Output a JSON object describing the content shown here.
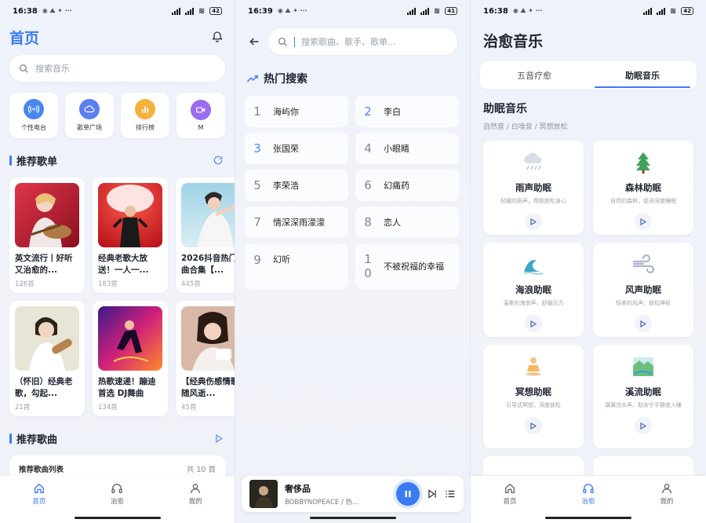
{
  "screen1": {
    "status": {
      "time": "16:38",
      "battery": "42"
    },
    "title": "首页",
    "search_placeholder": "搜索音乐",
    "quick": [
      {
        "label": "个性电台",
        "icon": "radio-icon",
        "color": "#4a86f0"
      },
      {
        "label": "歌单广场",
        "icon": "cloud-icon",
        "color": "#5b7ff0"
      },
      {
        "label": "排行榜",
        "icon": "chart-icon",
        "color": "#f3b23a"
      },
      {
        "label": "M",
        "icon": "video-icon",
        "color": "#9b6cf0"
      }
    ],
    "recommend_title": "推荐歌单",
    "playlists": [
      {
        "title": "英文流行丨好听又治愈的...",
        "count": "126首"
      },
      {
        "title": "经典老歌大放送！一人一...",
        "count": "183首"
      },
      {
        "title": "2026抖音热门歌曲合集【...",
        "count": "445首"
      },
      {
        "title": "（怀旧）经典老歌，勾起...",
        "count": "21首"
      },
      {
        "title": "热歌速递！蹦迪首选 DJ舞曲",
        "count": "134首"
      },
      {
        "title": "【经典伤感情歌】随风逝...",
        "count": "45首"
      }
    ],
    "songs_title": "推荐歌曲",
    "songs_list_label": "推荐歌曲列表",
    "songs_count": "共 10 首",
    "nav": [
      "首页",
      "治愈",
      "我的"
    ]
  },
  "screen2": {
    "status": {
      "time": "16:39",
      "battery": "41"
    },
    "search_placeholder": "搜索歌曲、歌手、歌单...",
    "hot_title": "热门搜索",
    "hot": [
      {
        "num": "1",
        "name": "海屿你"
      },
      {
        "num": "2",
        "name": "李白"
      },
      {
        "num": "3",
        "name": "张国荣"
      },
      {
        "num": "4",
        "name": "小眼睛"
      },
      {
        "num": "5",
        "name": "李荣浩"
      },
      {
        "num": "6",
        "name": "幻痛药"
      },
      {
        "num": "7",
        "name": "情深深雨濛濛"
      },
      {
        "num": "8",
        "name": "恋人"
      },
      {
        "num": "9",
        "name": "幻听"
      },
      {
        "num": "10",
        "name": "不被祝福的幸福"
      }
    ],
    "player": {
      "song": "奢侈品",
      "artist": "BOBBYNOPEACE / 热..."
    }
  },
  "screen3": {
    "status": {
      "time": "16:38",
      "battery": "42"
    },
    "title": "治愈音乐",
    "tabs": [
      "五音疗愈",
      "助眠音乐"
    ],
    "section_title": "助眠音乐",
    "section_sub": "自然音 / 白噪音 / 冥想放松",
    "items": [
      {
        "name": "雨声助眠",
        "desc": "轻缓的雨声，帮助放松身心",
        "icon": "rain-icon"
      },
      {
        "name": "森林助眠",
        "desc": "自然的森林，促进深度睡眠",
        "icon": "tree-icon"
      },
      {
        "name": "海浪助眠",
        "desc": "温柔的海浪声，舒缓压力",
        "icon": "wave-icon"
      },
      {
        "name": "风声助眠",
        "desc": "轻柔的风声，放松神经",
        "icon": "wind-icon"
      },
      {
        "name": "冥想助眠",
        "desc": "引导式冥想，深度放松",
        "icon": "meditation-icon"
      },
      {
        "name": "溪流助眠",
        "desc": "潺潺流水声，助安宁平静度入睡",
        "icon": "stream-icon"
      }
    ],
    "nav": [
      "首页",
      "治愈",
      "我的"
    ]
  }
}
